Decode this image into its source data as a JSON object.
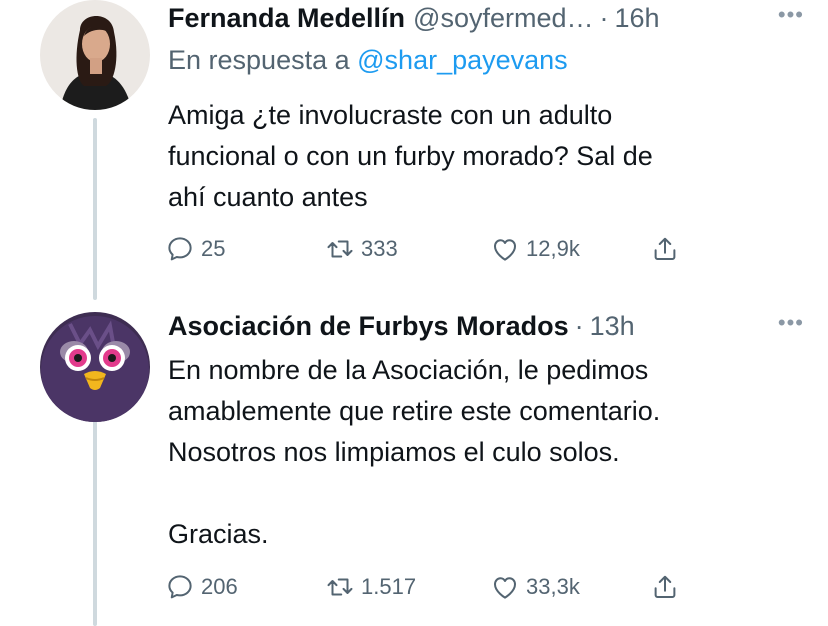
{
  "tweets": [
    {
      "name": "Fernanda Medellín",
      "handle": "@soyfermed…",
      "sep": "·",
      "time": "16h",
      "reply_prefix": "En respuesta a",
      "reply_handle": "@shar_payevans",
      "text": "Amiga ¿te involucraste con un adulto\nfuncional o con un furby morado? Sal de\nahí cuanto antes",
      "replies": "25",
      "retweets": "333",
      "likes": "12,9k"
    },
    {
      "name": "Asociación de Furbys Morados",
      "sep": "·",
      "time": "13h",
      "text": "En nombre de la Asociación, le pedimos\namablemente que retire este comentario.\nNosotros nos limpiamos el culo solos.\n\nGracias.",
      "replies": "206",
      "retweets": "1.517",
      "likes": "33,3k"
    }
  ],
  "icons": {
    "more": "more-dots-icon",
    "reply": "reply-bubble-icon",
    "retweet": "retweet-icon",
    "like": "heart-icon",
    "share": "share-icon"
  },
  "colors": {
    "text": "#0f1419",
    "secondary": "#536471",
    "link": "#1d9bf0",
    "thread_line": "#cfd9de"
  }
}
